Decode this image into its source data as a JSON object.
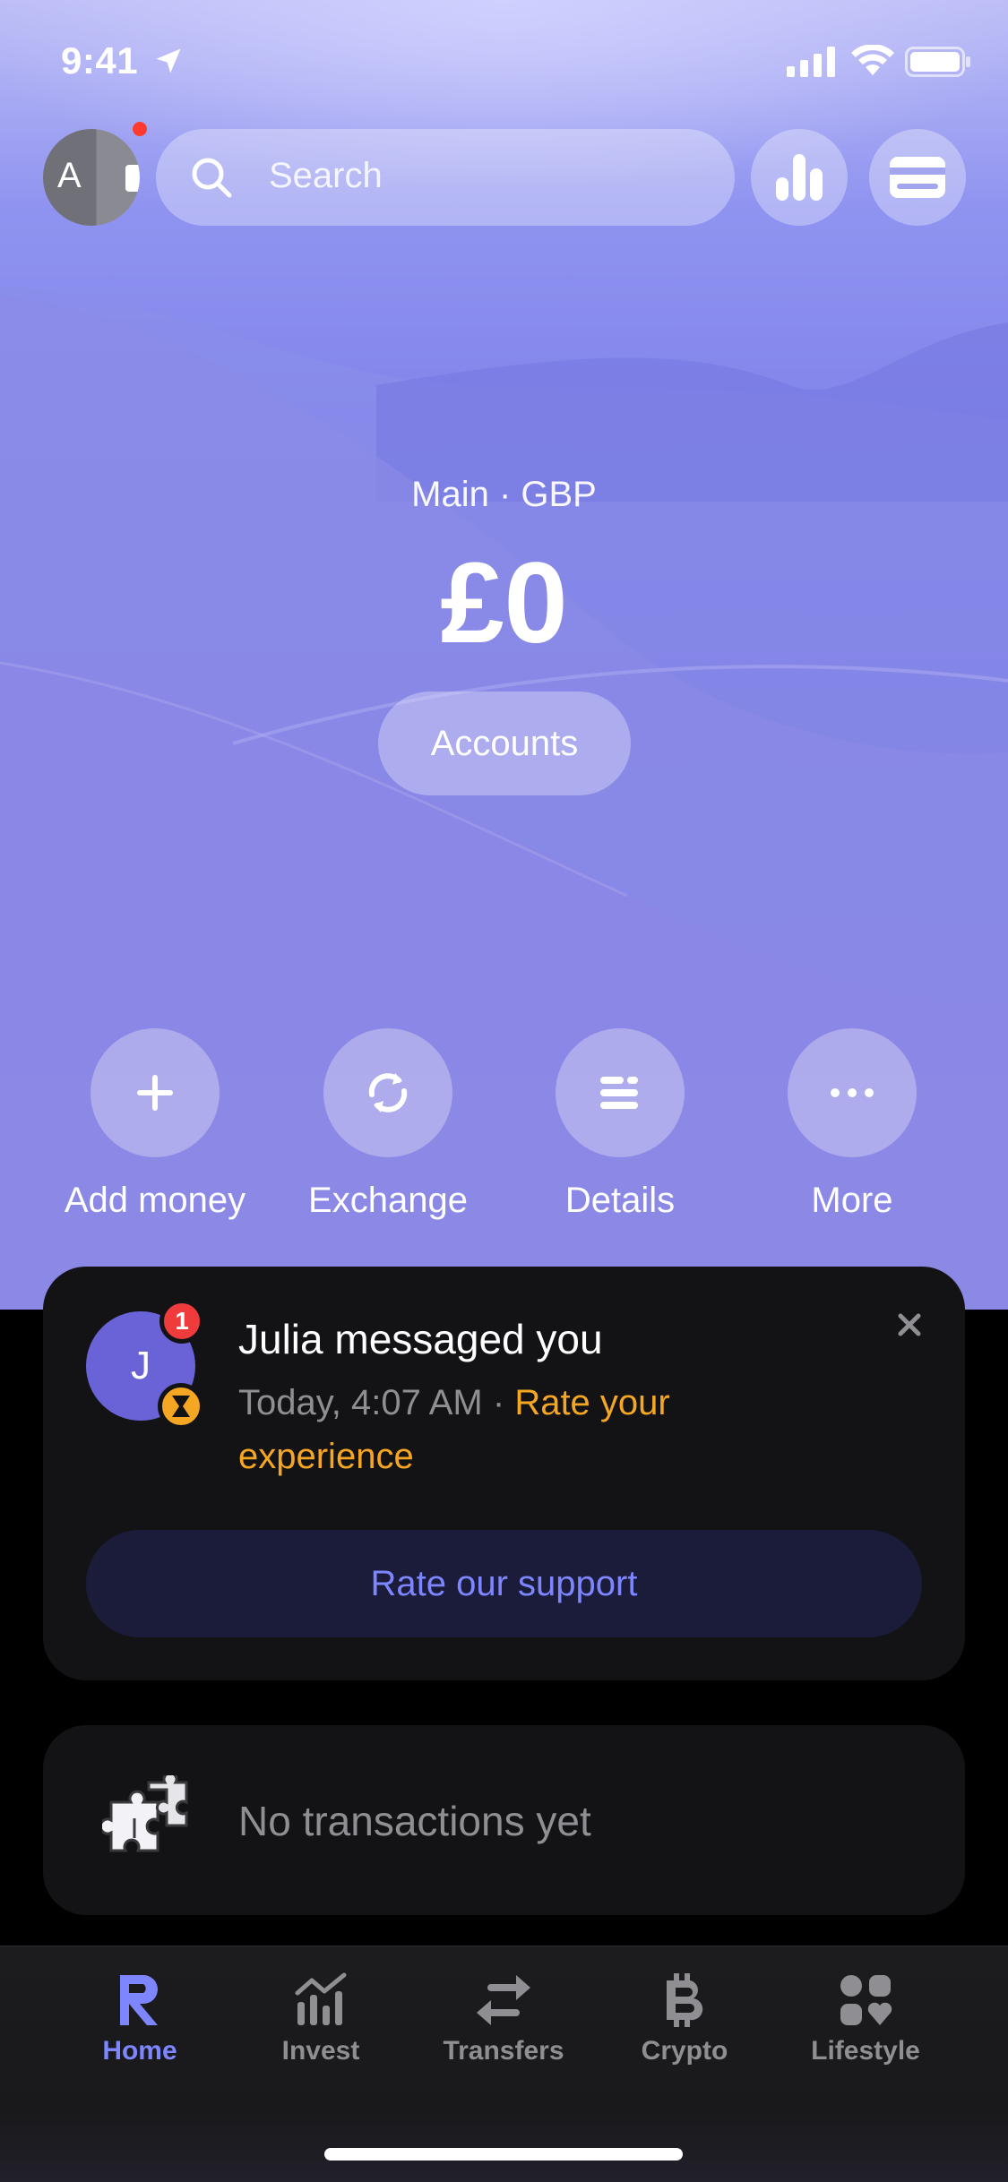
{
  "status_bar": {
    "time": "9:41"
  },
  "header": {
    "avatar_initial": "A",
    "search_placeholder": "Search"
  },
  "account": {
    "label": "Main · GBP",
    "balance": "£0",
    "accounts_button": "Accounts"
  },
  "actions": [
    {
      "label": "Add money",
      "icon": "plus-icon"
    },
    {
      "label": "Exchange",
      "icon": "exchange-icon"
    },
    {
      "label": "Details",
      "icon": "details-icon"
    },
    {
      "label": "More",
      "icon": "more-icon"
    }
  ],
  "notification": {
    "avatar_initial": "J",
    "badge_count": "1",
    "title": "Julia messaged you",
    "timestamp": "Today, 4:07 AM",
    "separator": " · ",
    "link_text": "Rate your experience",
    "button_label": "Rate our support"
  },
  "transactions": {
    "empty_text": "No transactions yet"
  },
  "tabs": [
    {
      "label": "Home",
      "icon": "revolut-logo-icon",
      "active": true
    },
    {
      "label": "Invest",
      "icon": "chart-icon",
      "active": false
    },
    {
      "label": "Transfers",
      "icon": "transfer-arrows-icon",
      "active": false
    },
    {
      "label": "Crypto",
      "icon": "bitcoin-icon",
      "active": false
    },
    {
      "label": "Lifestyle",
      "icon": "lifestyle-icon",
      "active": false
    }
  ],
  "colors": {
    "accent": "#7e86ff",
    "warning": "#f5a623",
    "badge_red": "#ef3b3b",
    "card_bg": "#131316"
  }
}
